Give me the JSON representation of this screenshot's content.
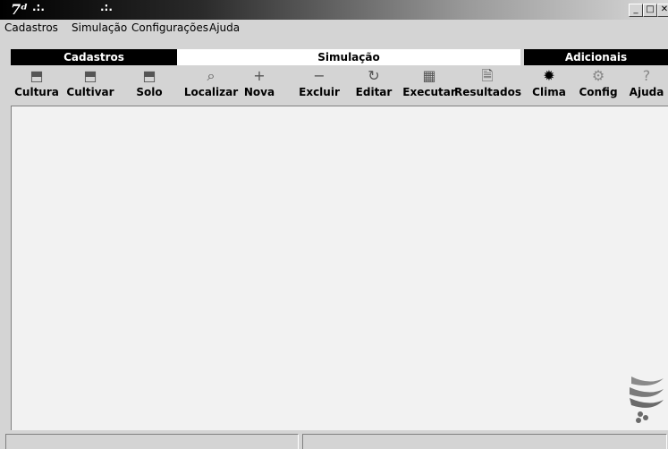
{
  "window": {
    "app_icon_glyph": "7ᵈ",
    "title_part1": ".:.",
    "title_part2": ".:.",
    "controls": [
      "_",
      "□",
      "✕"
    ]
  },
  "menu": [
    {
      "label": "Cadastros"
    },
    {
      "label": "Simulação"
    },
    {
      "label": "Configurações"
    },
    {
      "label": "Ajuda"
    }
  ],
  "sections": {
    "cadastros": "Cadastros",
    "simulacao": "Simulação",
    "adicionais": "Adicionais"
  },
  "toolbar": [
    {
      "label": "Cultura",
      "icon": "image-icon",
      "glyph": "⬒"
    },
    {
      "label": "Cultivar",
      "icon": "image-icon",
      "glyph": "⬒"
    },
    {
      "label": "Solo",
      "icon": "image-icon",
      "glyph": "⬒"
    },
    {
      "label": "Localizar",
      "icon": "search-icon",
      "glyph": "⌕"
    },
    {
      "label": "Nova",
      "icon": "plus-icon",
      "glyph": "+"
    },
    {
      "label": "Excluir",
      "icon": "minus-icon",
      "glyph": "−"
    },
    {
      "label": "Editar",
      "icon": "refresh-icon",
      "glyph": "↻"
    },
    {
      "label": "Executar",
      "icon": "run-icon",
      "glyph": "▦"
    },
    {
      "label": "Resultados",
      "icon": "document-check-icon",
      "glyph": "🗎"
    },
    {
      "label": "Clima",
      "icon": "gear-icon",
      "glyph": "✹"
    },
    {
      "label": "Config",
      "icon": "config-icon",
      "glyph": "⚙"
    },
    {
      "label": "Ajuda",
      "icon": "help-icon",
      "glyph": "?"
    }
  ],
  "colors": {
    "section_dark": "#000000",
    "section_light": "#ffffff",
    "chrome": "#d4d4d4",
    "workspace": "#f2f2f2"
  }
}
